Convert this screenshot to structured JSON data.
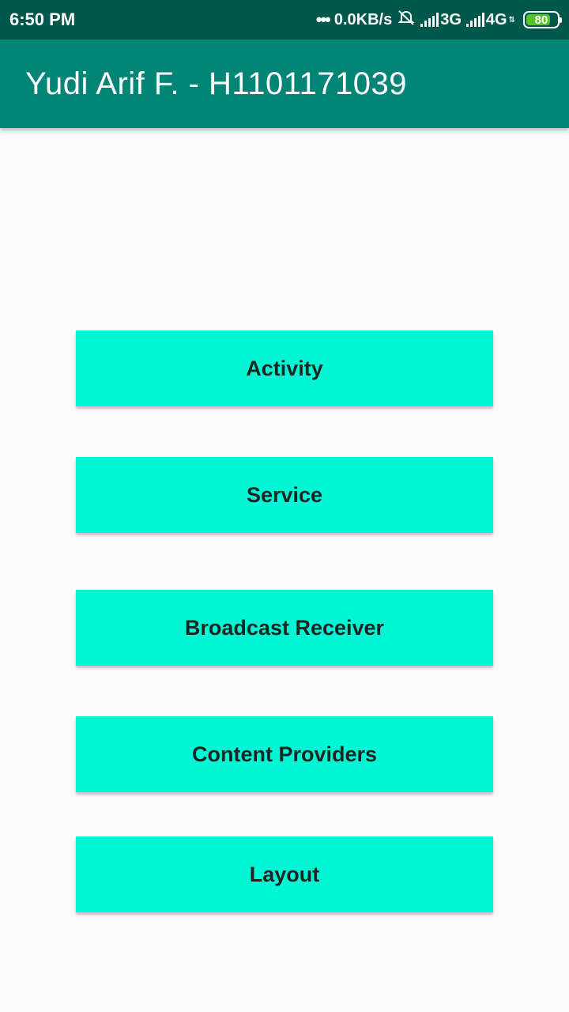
{
  "status_bar": {
    "time": "6:50 PM",
    "dots": "•••",
    "speed": "0.0KB/s",
    "net1": "3G",
    "net2": "4G",
    "battery": "80",
    "icons": [
      "mute-icon",
      "signal-icon",
      "battery-icon"
    ],
    "battery_color": "#58c322",
    "battery_level": 0.8
  },
  "app_bar": {
    "title": "Yudi Arif F. - H1101171039",
    "color": "#008577"
  },
  "buttons": {
    "items": [
      {
        "label": "Activity"
      },
      {
        "label": "Service"
      },
      {
        "label": "Broadcast Receiver"
      },
      {
        "label": "Content Providers"
      },
      {
        "label": "Layout"
      }
    ],
    "color": "#00f7d6"
  }
}
